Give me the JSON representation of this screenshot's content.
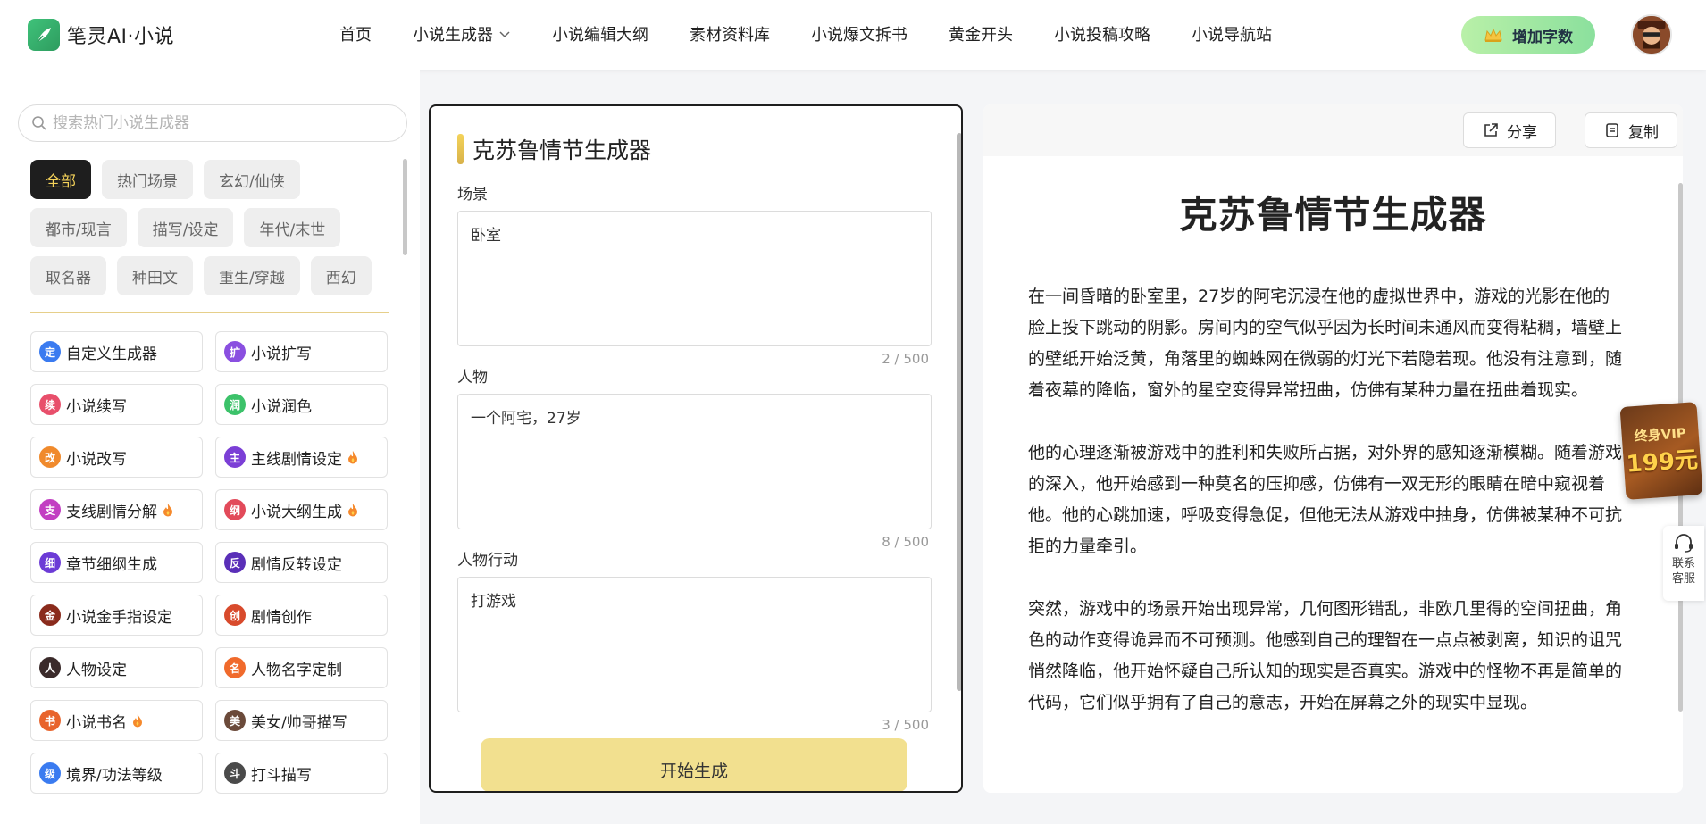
{
  "header": {
    "logo_text": "笔灵AI·小说",
    "nav": [
      {
        "label": "首页"
      },
      {
        "label": "小说生成器"
      },
      {
        "label": "小说编辑大纲"
      },
      {
        "label": "素材资料库"
      },
      {
        "label": "小说爆文拆书"
      },
      {
        "label": "黄金开头"
      },
      {
        "label": "小说投稿攻略"
      },
      {
        "label": "小说导航站"
      }
    ],
    "vip_button": "增加字数"
  },
  "sidebar": {
    "search_placeholder": "搜索热门小说生成器",
    "categories": [
      "全部",
      "热门场景",
      "玄幻/仙侠",
      "都市/现言",
      "描写/设定",
      "年代/末世",
      "取名器",
      "种田文",
      "重生/穿越",
      "西幻"
    ],
    "active_category": "全部",
    "tools": [
      {
        "label": "自定义生成器",
        "icon": "定",
        "color": "#3a7bf0",
        "hot": false
      },
      {
        "label": "小说扩写",
        "icon": "扩",
        "color": "#8a4fe0",
        "hot": false
      },
      {
        "label": "小说续写",
        "icon": "续",
        "color": "#e84f6b",
        "hot": false
      },
      {
        "label": "小说润色",
        "icon": "润",
        "color": "#3cc26a",
        "hot": false
      },
      {
        "label": "小说改写",
        "icon": "改",
        "color": "#f08a2c",
        "hot": false
      },
      {
        "label": "主线剧情设定",
        "icon": "主",
        "color": "#7b3fd6",
        "hot": true
      },
      {
        "label": "支线剧情分解",
        "icon": "支",
        "color": "#c23fc2",
        "hot": true
      },
      {
        "label": "小说大纲生成",
        "icon": "纲",
        "color": "#e24a5a",
        "hot": true
      },
      {
        "label": "章节细纲生成",
        "icon": "细",
        "color": "#6c3bd6",
        "hot": false
      },
      {
        "label": "剧情反转设定",
        "icon": "反",
        "color": "#5a2fb8",
        "hot": false
      },
      {
        "label": "小说金手指设定",
        "icon": "金",
        "color": "#8a2b1c",
        "hot": false
      },
      {
        "label": "剧情创作",
        "icon": "创",
        "color": "#d84a2c",
        "hot": false
      },
      {
        "label": "人物设定",
        "icon": "人",
        "color": "#3a2a2a",
        "hot": false
      },
      {
        "label": "人物名字定制",
        "icon": "名",
        "color": "#f06a2c",
        "hot": false
      },
      {
        "label": "小说书名",
        "icon": "书",
        "color": "#e8642c",
        "hot": true
      },
      {
        "label": "美女/帅哥描写",
        "icon": "美",
        "color": "#6b4a3a",
        "hot": false
      },
      {
        "label": "境界/功法等级",
        "icon": "级",
        "color": "#3a7bf0",
        "hot": false
      },
      {
        "label": "打斗描写",
        "icon": "斗",
        "color": "#4a4a4a",
        "hot": false
      }
    ]
  },
  "form": {
    "title": "克苏鲁情节生成器",
    "fields": [
      {
        "label": "场景",
        "value": "卧室",
        "count": "2 / 500"
      },
      {
        "label": "人物",
        "value": "一个阿宅，27岁",
        "count": "8 / 500"
      },
      {
        "label": "人物行动",
        "value": "打游戏",
        "count": "3 / 500"
      }
    ],
    "submit": "开始生成"
  },
  "output": {
    "share": "分享",
    "copy": "复制",
    "title": "克苏鲁情节生成器",
    "paragraphs": [
      "在一间昏暗的卧室里，27岁的阿宅沉浸在他的虚拟世界中，游戏的光影在他的脸上投下跳动的阴影。房间内的空气似乎因为长时间未通风而变得粘稠，墙壁上的壁纸开始泛黄，角落里的蜘蛛网在微弱的灯光下若隐若现。他没有注意到，随着夜幕的降临，窗外的星空变得异常扭曲，仿佛有某种力量在扭曲着现实。",
      "他的心理逐渐被游戏中的胜利和失败所占据，对外界的感知逐渐模糊。随着游戏的深入，他开始感到一种莫名的压抑感，仿佛有一双无形的眼睛在暗中窥视着他。他的心跳加速，呼吸变得急促，但他无法从游戏中抽身，仿佛被某种不可抗拒的力量牵引。",
      "突然，游戏中的场景开始出现异常，几何图形错乱，非欧几里得的空间扭曲，角色的动作变得诡异而不可预测。他感到自己的理智在一点点被剥离，知识的诅咒悄然降临，他开始怀疑自己所认知的现实是否真实。游戏中的怪物不再是简单的代码，它们似乎拥有了自己的意志，开始在屏幕之外的现实中显现。"
    ]
  },
  "floating": {
    "vip_line1": "终身VIP",
    "vip_line2": "199元",
    "service": "联系客服"
  }
}
